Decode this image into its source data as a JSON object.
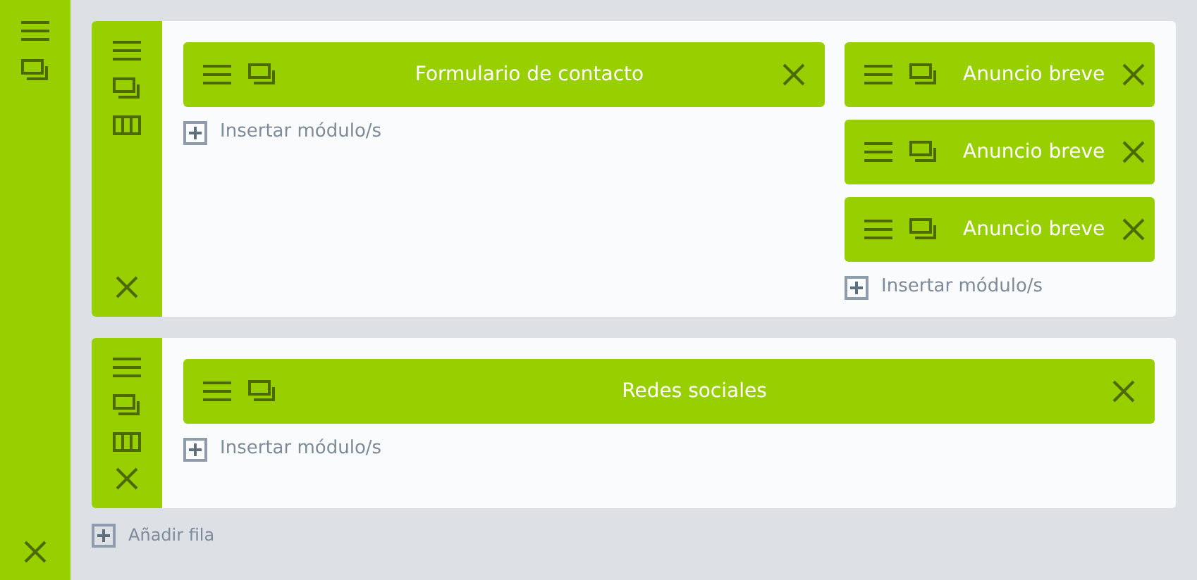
{
  "rows": [
    {
      "columns": [
        {
          "modules": [
            {
              "title": "Formulario de contacto"
            }
          ],
          "insert_label": "Insertar módulo/s"
        },
        {
          "modules": [
            {
              "title": "Anuncio breve"
            },
            {
              "title": "Anuncio breve"
            },
            {
              "title": "Anuncio breve"
            }
          ],
          "insert_label": "Insertar módulo/s"
        }
      ]
    },
    {
      "columns": [
        {
          "modules": [
            {
              "title": "Redes sociales"
            }
          ],
          "insert_label": "Insertar módulo/s"
        }
      ]
    }
  ],
  "add_row_label": "Añadir fila"
}
